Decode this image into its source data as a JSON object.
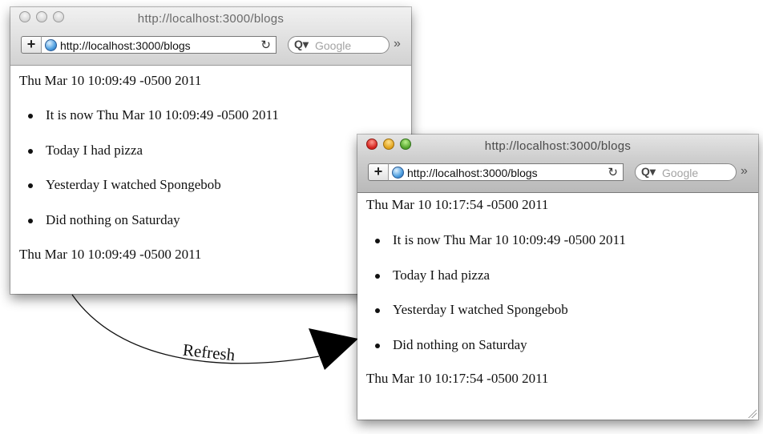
{
  "window1": {
    "title": "http://localhost:3000/blogs",
    "url": "http://localhost:3000/blogs",
    "search_placeholder": "Google",
    "add_label": "+",
    "reload_glyph": "↻",
    "overflow_glyph": "»",
    "search_glyph": "Q▾",
    "date_top": "Thu Mar 10 10:09:49 -0500 2011",
    "items": [
      "It is now Thu Mar 10 10:09:49 -0500 2011",
      "Today I had pizza",
      "Yesterday I watched Spongebob",
      "Did nothing on Saturday"
    ],
    "date_bottom": "Thu Mar 10 10:09:49 -0500 2011"
  },
  "window2": {
    "title": "http://localhost:3000/blogs",
    "url": "http://localhost:3000/blogs",
    "search_placeholder": "Google",
    "add_label": "+",
    "reload_glyph": "↻",
    "overflow_glyph": "»",
    "search_glyph": "Q▾",
    "date_top": "Thu Mar 10 10:17:54 -0500 2011",
    "items": [
      "It is now Thu Mar 10 10:09:49 -0500 2011",
      "Today I had pizza",
      "Yesterday I watched Spongebob",
      "Did nothing on Saturday"
    ],
    "date_bottom": "Thu Mar 10 10:17:54 -0500 2011"
  },
  "annotation": {
    "label": "Refresh"
  },
  "icons": [
    "close-icon",
    "minimize-icon",
    "zoom-icon",
    "globe-icon",
    "reload-icon",
    "search-icon",
    "chevron-right-icon",
    "resize-grip-icon",
    "arrow-icon"
  ]
}
